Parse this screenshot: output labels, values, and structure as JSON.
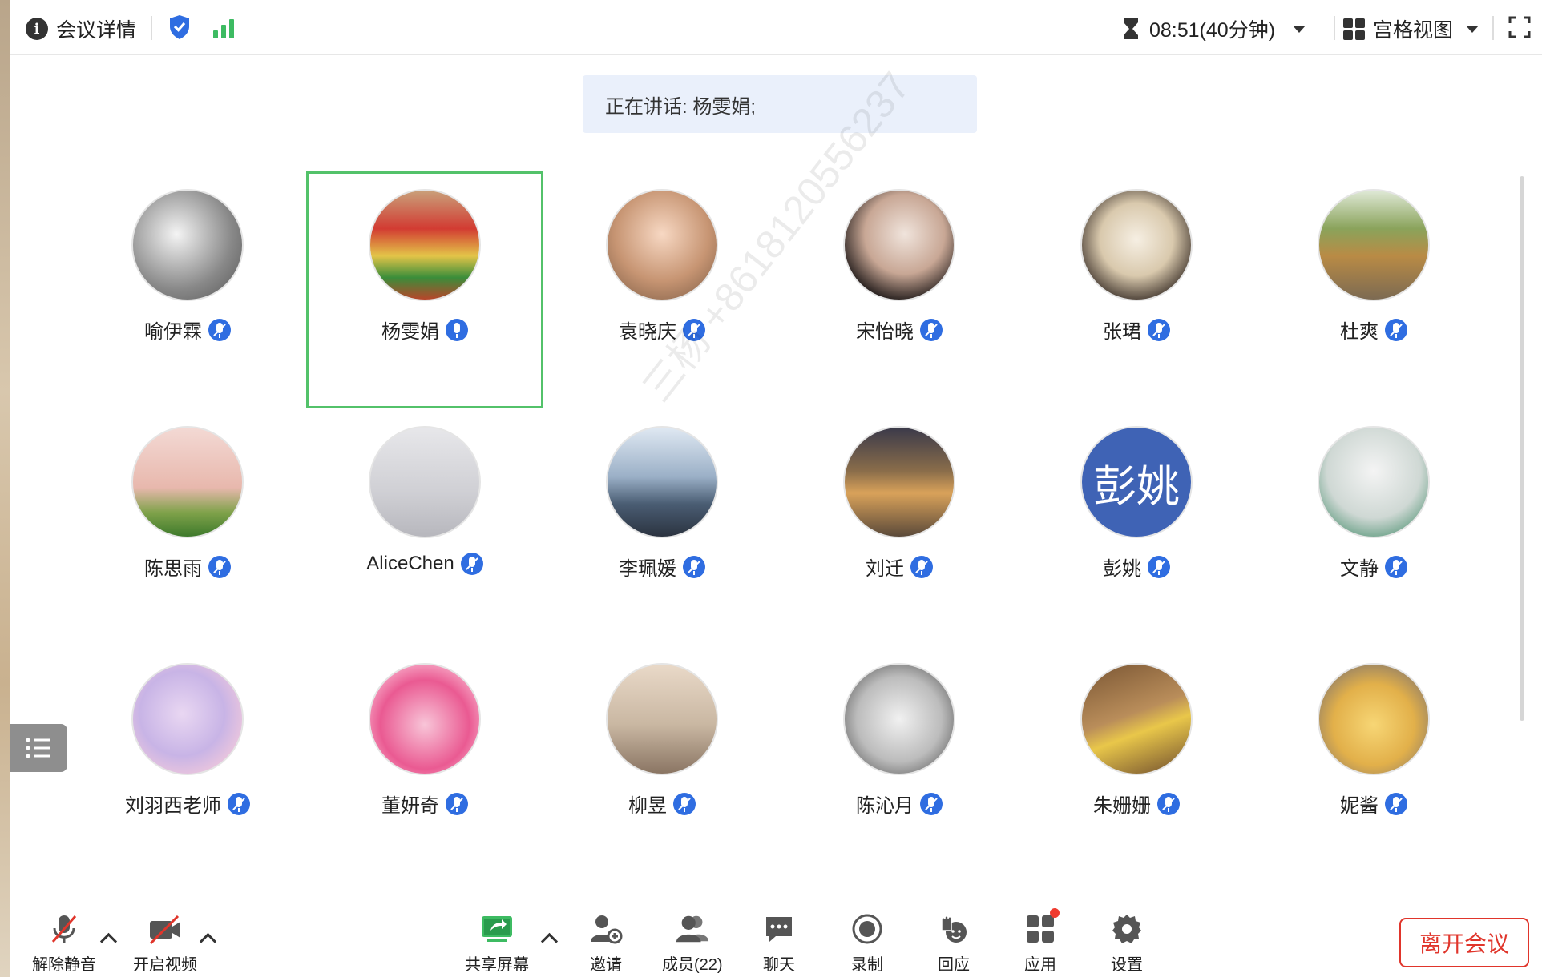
{
  "topbar": {
    "meeting_details": "会议详情",
    "timer": "08:51(40分钟)",
    "view_mode": "宫格视图"
  },
  "speaking_banner": "正在讲话: 杨雯娟;",
  "watermark": "三杨 +8618120556237",
  "participants": [
    {
      "name": "喻伊霖",
      "mic": "muted"
    },
    {
      "name": "杨雯娟",
      "mic": "on"
    },
    {
      "name": "袁晓庆",
      "mic": "muted"
    },
    {
      "name": "宋怡晓",
      "mic": "muted"
    },
    {
      "name": "张珺",
      "mic": "muted"
    },
    {
      "name": "杜爽",
      "mic": "muted"
    },
    {
      "name": "陈思雨",
      "mic": "muted"
    },
    {
      "name": "AliceChen",
      "mic": "muted"
    },
    {
      "name": "李珮媛",
      "mic": "muted"
    },
    {
      "name": "刘迁",
      "mic": "muted"
    },
    {
      "name": "彭姚",
      "mic": "muted",
      "avatar_text": "彭姚"
    },
    {
      "name": "文静",
      "mic": "muted"
    },
    {
      "name": "刘羽西老师",
      "mic": "muted"
    },
    {
      "name": "董妍奇",
      "mic": "muted"
    },
    {
      "name": "柳昱",
      "mic": "muted"
    },
    {
      "name": "陈沁月",
      "mic": "muted"
    },
    {
      "name": "朱姗姗",
      "mic": "muted"
    },
    {
      "name": "妮酱",
      "mic": "muted"
    }
  ],
  "toolbar": {
    "unmute": "解除静音",
    "start_video": "开启视频",
    "share_screen": "共享屏幕",
    "invite": "邀请",
    "members": "成员(22)",
    "chat": "聊天",
    "record": "录制",
    "react": "回应",
    "apps": "应用",
    "settings": "设置",
    "leave": "离开会议"
  },
  "colors": {
    "accent_blue": "#2f6de1",
    "active_border": "#53c26a",
    "leave_red": "#e0352b",
    "signal_green": "#3dbb62"
  }
}
